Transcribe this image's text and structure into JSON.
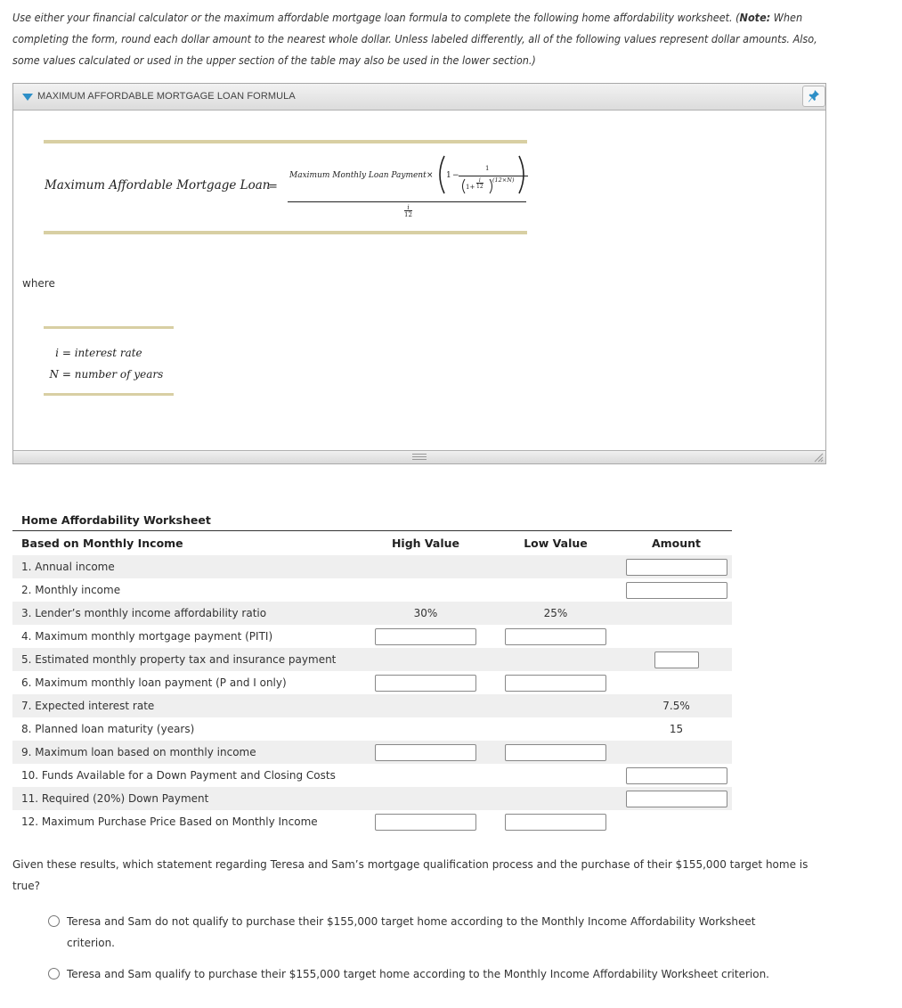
{
  "intro": {
    "text_before_note": "Use either your financial calculator or the maximum affordable mortgage loan formula to complete the following home affordability worksheet. (",
    "note_label": "Note:",
    "text_after_note": " When completing the form, round each dollar amount to the nearest whole dollar. Unless labeled differently, all of the following values represent dollar amounts. Also, some values calculated or used in the upper section of the table may also be used in the lower section.)"
  },
  "formula_panel": {
    "title": "MAXIMUM AFFORDABLE MORTGAGE LOAN FORMULA",
    "expanded": true,
    "lhs": "Maximum Affordable Mortgage Loan",
    "equals": "=",
    "numerator_term": "Maximum Monthly Loan Payment",
    "times": "×",
    "one": "1",
    "minus": "−",
    "inner_one": "1",
    "one_plus": "1+",
    "i": "i",
    "twelve": "12",
    "exponent": "(12×N)",
    "where_label": "where",
    "definitions": [
      {
        "symbol": "i",
        "eq": "=",
        "meaning": "interest rate"
      },
      {
        "symbol": "N",
        "eq": "=",
        "meaning": "number of years"
      }
    ]
  },
  "worksheet": {
    "title": "Home Affordability Worksheet",
    "headers": {
      "label": "Based on Monthly Income",
      "high": "High Value",
      "low": "Low Value",
      "amount": "Amount"
    },
    "rows": [
      {
        "label": "1. Annual income",
        "high": null,
        "low": null,
        "amount": "input"
      },
      {
        "label": "2. Monthly income",
        "high": null,
        "low": null,
        "amount": "input"
      },
      {
        "label": "3. Lender’s monthly income affordability ratio",
        "high": "30%",
        "low": "25%",
        "amount": null
      },
      {
        "label": "4. Maximum monthly mortgage payment (PITI)",
        "high": "input",
        "low": "input",
        "amount": null
      },
      {
        "label": "5. Estimated monthly property tax and insurance payment",
        "high": null,
        "low": null,
        "amount": "input-small"
      },
      {
        "label": "6. Maximum monthly loan payment (P and I only)",
        "high": "input",
        "low": "input",
        "amount": null
      },
      {
        "label": "7. Expected interest rate",
        "high": null,
        "low": null,
        "amount": "7.5%"
      },
      {
        "label": "8. Planned loan maturity (years)",
        "high": null,
        "low": null,
        "amount": "15"
      },
      {
        "label": "9. Maximum loan based on monthly income",
        "high": "input",
        "low": "input",
        "amount": null
      },
      {
        "label": "10. Funds Available for a Down Payment and Closing Costs",
        "high": null,
        "low": null,
        "amount": "input"
      },
      {
        "label": "11. Required (20%) Down Payment",
        "high": null,
        "low": null,
        "amount": "input"
      },
      {
        "label": "12. Maximum Purchase Price Based on Monthly Income",
        "high": "input",
        "low": "input",
        "amount": null
      }
    ]
  },
  "question": {
    "text": "Given these results, which statement regarding Teresa and Sam’s mortgage qualification process and the purchase of their $155,000 target home is true?",
    "options": [
      {
        "label": "Teresa and Sam do not qualify to purchase their $155,000 target home according to the Monthly Income Affordability Worksheet criterion.",
        "selected": false
      },
      {
        "label": "Teresa and Sam qualify to purchase their $155,000 target home according to the Monthly Income Affordability Worksheet criterion.",
        "selected": false
      }
    ]
  },
  "colors": {
    "accent_blue": "#2d8fc7",
    "formula_rule": "#d8cfa3",
    "row_stripe": "#efefef"
  }
}
